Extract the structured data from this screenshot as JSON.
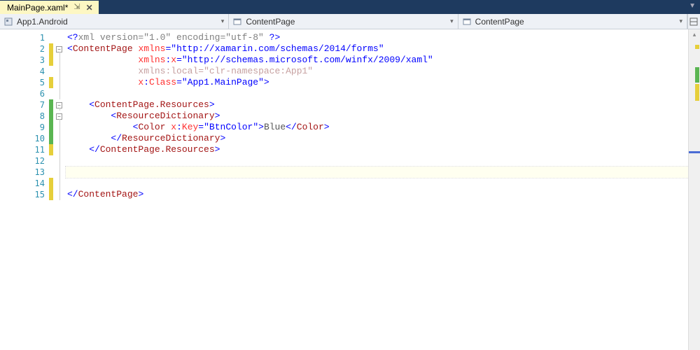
{
  "tab": {
    "filename": "MainPage.xaml*",
    "close_glyph": "✕",
    "pin_glyph": "⇲"
  },
  "crumbs": {
    "project": "App1.Android",
    "class": "ContentPage",
    "member": "ContentPage"
  },
  "code": {
    "lines": [
      {
        "n": 1,
        "fold": "",
        "change": "",
        "tokens": [
          [
            "sym",
            "<?"
          ],
          [
            "pi",
            "xml version=\"1.0\" encoding=\"utf-8\" "
          ],
          [
            "sym",
            "?>"
          ]
        ]
      },
      {
        "n": 2,
        "fold": "open",
        "change": "yellow",
        "tokens": [
          [
            "sym",
            "<"
          ],
          [
            "tag",
            "ContentPage"
          ],
          [
            "txt",
            " "
          ],
          [
            "attr",
            "xmlns"
          ],
          [
            "sym",
            "="
          ],
          [
            "str",
            "\"http://xamarin.com/schemas/2014/forms\""
          ]
        ]
      },
      {
        "n": 3,
        "fold": "line",
        "change": "yellow",
        "tokens": [
          [
            "txt",
            "             "
          ],
          [
            "attr",
            "xmlns"
          ],
          [
            "sym",
            ":"
          ],
          [
            "attr",
            "x"
          ],
          [
            "sym",
            "="
          ],
          [
            "str",
            "\"http://schemas.microsoft.com/winfx/2009/xaml\""
          ]
        ]
      },
      {
        "n": 4,
        "fold": "line",
        "change": "",
        "tokens": [
          [
            "txt",
            "             "
          ],
          [
            "attr-dim",
            "xmlns"
          ],
          [
            "attr-dim",
            ":"
          ],
          [
            "attr-dim",
            "local"
          ],
          [
            "attr-dim",
            "=\"clr-namespace:App1\""
          ]
        ]
      },
      {
        "n": 5,
        "fold": "line",
        "change": "yellow",
        "tokens": [
          [
            "txt",
            "             "
          ],
          [
            "attr",
            "x"
          ],
          [
            "sym",
            ":"
          ],
          [
            "attr",
            "Class"
          ],
          [
            "sym",
            "="
          ],
          [
            "str",
            "\"App1.MainPage\""
          ],
          [
            "sym",
            ">"
          ]
        ]
      },
      {
        "n": 6,
        "fold": "line",
        "change": "",
        "tokens": []
      },
      {
        "n": 7,
        "fold": "open",
        "change": "green",
        "tokens": [
          [
            "txt",
            "    "
          ],
          [
            "sym",
            "<"
          ],
          [
            "tag",
            "ContentPage.Resources"
          ],
          [
            "sym",
            ">"
          ]
        ]
      },
      {
        "n": 8,
        "fold": "open",
        "change": "green",
        "tokens": [
          [
            "txt",
            "        "
          ],
          [
            "sym",
            "<"
          ],
          [
            "tag",
            "ResourceDictionary"
          ],
          [
            "sym",
            ">"
          ]
        ]
      },
      {
        "n": 9,
        "fold": "line",
        "change": "green",
        "tokens": [
          [
            "txt",
            "            "
          ],
          [
            "sym",
            "<"
          ],
          [
            "tag",
            "Color"
          ],
          [
            "txt",
            " "
          ],
          [
            "attr",
            "x"
          ],
          [
            "sym",
            ":"
          ],
          [
            "attr",
            "Key"
          ],
          [
            "sym",
            "="
          ],
          [
            "str",
            "\"BtnColor\""
          ],
          [
            "sym",
            ">"
          ],
          [
            "txt",
            "Blue"
          ],
          [
            "sym",
            "</"
          ],
          [
            "tag",
            "Color"
          ],
          [
            "sym",
            ">"
          ]
        ]
      },
      {
        "n": 10,
        "fold": "line",
        "change": "green",
        "tokens": [
          [
            "txt",
            "        "
          ],
          [
            "sym",
            "</"
          ],
          [
            "tag",
            "ResourceDictionary"
          ],
          [
            "sym",
            ">"
          ]
        ]
      },
      {
        "n": 11,
        "fold": "line",
        "change": "yellow",
        "tokens": [
          [
            "txt",
            "    "
          ],
          [
            "sym",
            "</"
          ],
          [
            "tag",
            "ContentPage.Resources"
          ],
          [
            "sym",
            ">"
          ]
        ]
      },
      {
        "n": 12,
        "fold": "line",
        "change": "",
        "tokens": []
      },
      {
        "n": 13,
        "fold": "line",
        "change": "",
        "current": true,
        "tokens": [
          [
            "txt",
            "    "
          ]
        ]
      },
      {
        "n": 14,
        "fold": "line",
        "change": "yellow",
        "tokens": []
      },
      {
        "n": 15,
        "fold": "line",
        "change": "yellow",
        "tokens": [
          [
            "sym",
            "</"
          ],
          [
            "tag",
            "ContentPage"
          ],
          [
            "sym",
            ">"
          ]
        ]
      }
    ]
  }
}
